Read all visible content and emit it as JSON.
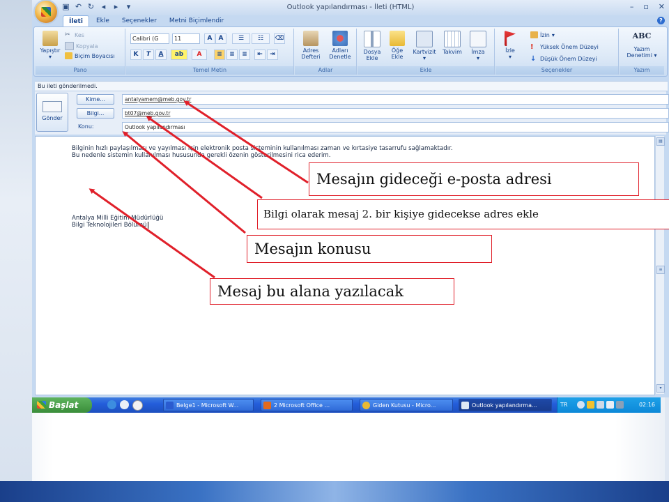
{
  "window": {
    "title": "Outlook yapılandırması - İleti (HTML)",
    "tabs": [
      "İleti",
      "Ekle",
      "Seçenekler",
      "Metni Biçimlendir"
    ],
    "active_tab": "İleti"
  },
  "ribbon": {
    "pano": {
      "label": "Pano",
      "paste": "Yapıştır",
      "cut": "Kes",
      "copy": "Kopyala",
      "format_painter": "Biçim Boyacısı"
    },
    "temel_metin": {
      "label": "Temel Metin",
      "font": "Calibri (G",
      "size": "11"
    },
    "adlar": {
      "label": "Adlar",
      "address_book": "Adres Defteri",
      "check_names": "Adları Denetle"
    },
    "ekle": {
      "label": "Ekle",
      "attach_file": "Dosya Ekle",
      "attach_item": "Öğe Ekle",
      "business_card": "Kartvizit",
      "calendar": "Takvim",
      "signature": "İmza"
    },
    "secenekler": {
      "label": "Seçenekler",
      "follow_up": "İzle",
      "permission": "İzin",
      "high_importance": "Yüksek Önem Düzeyi",
      "low_importance": "Düşük Önem Düzeyi"
    },
    "yazim": {
      "label": "Yazım",
      "spelling_icon_text": "ABC",
      "spelling": "Yazım Denetimi"
    }
  },
  "info_bar": "Bu ileti gönderilmedi.",
  "compose": {
    "send_label": "Gönder",
    "to_button": "Kime...",
    "cc_button": "Bilgi...",
    "subject_label": "Konu:",
    "to_value": "antalyamem@meb.gov.tr",
    "cc_value": "bt07@meb.gov.tr",
    "subject_value": "Outlook yapılandırması"
  },
  "body": {
    "line1": "Bilginin hızlı paylaşılması ve yayılması için elektronik posta sisteminin kullanılması zaman ve kırtasiye tasarrufu sağlamaktadır.",
    "line2": "Bu nedenle sistemin kullanılması hususunda gerekli özenin gösterilmesini rica ederim.",
    "sig1": "Antalya Milli Eğitim Müdürlüğü",
    "sig2": "Bilgi Teknolojileri Bölümü"
  },
  "taskbar": {
    "start": "Başlat",
    "tasks": [
      "Belge1 - Microsoft W...",
      "2 Microsoft Office ...",
      "Giden Kutusu - Micro...",
      "Outlook yapılandırma..."
    ],
    "language": "TR",
    "clock": "02:16"
  },
  "annotations": {
    "email_address": "Mesajın gideceği e-posta adresi",
    "cc_info": "Bilgi olarak mesaj 2. bir kişiye gidecekse adres ekle",
    "subject": "Mesajın konusu",
    "body": "Mesaj bu alana yazılacak"
  },
  "colors": {
    "arrow": "#e0202a",
    "ribbon_text": "#15428b",
    "taskbar": "#245edb",
    "start_button": "#3a8d3a"
  }
}
